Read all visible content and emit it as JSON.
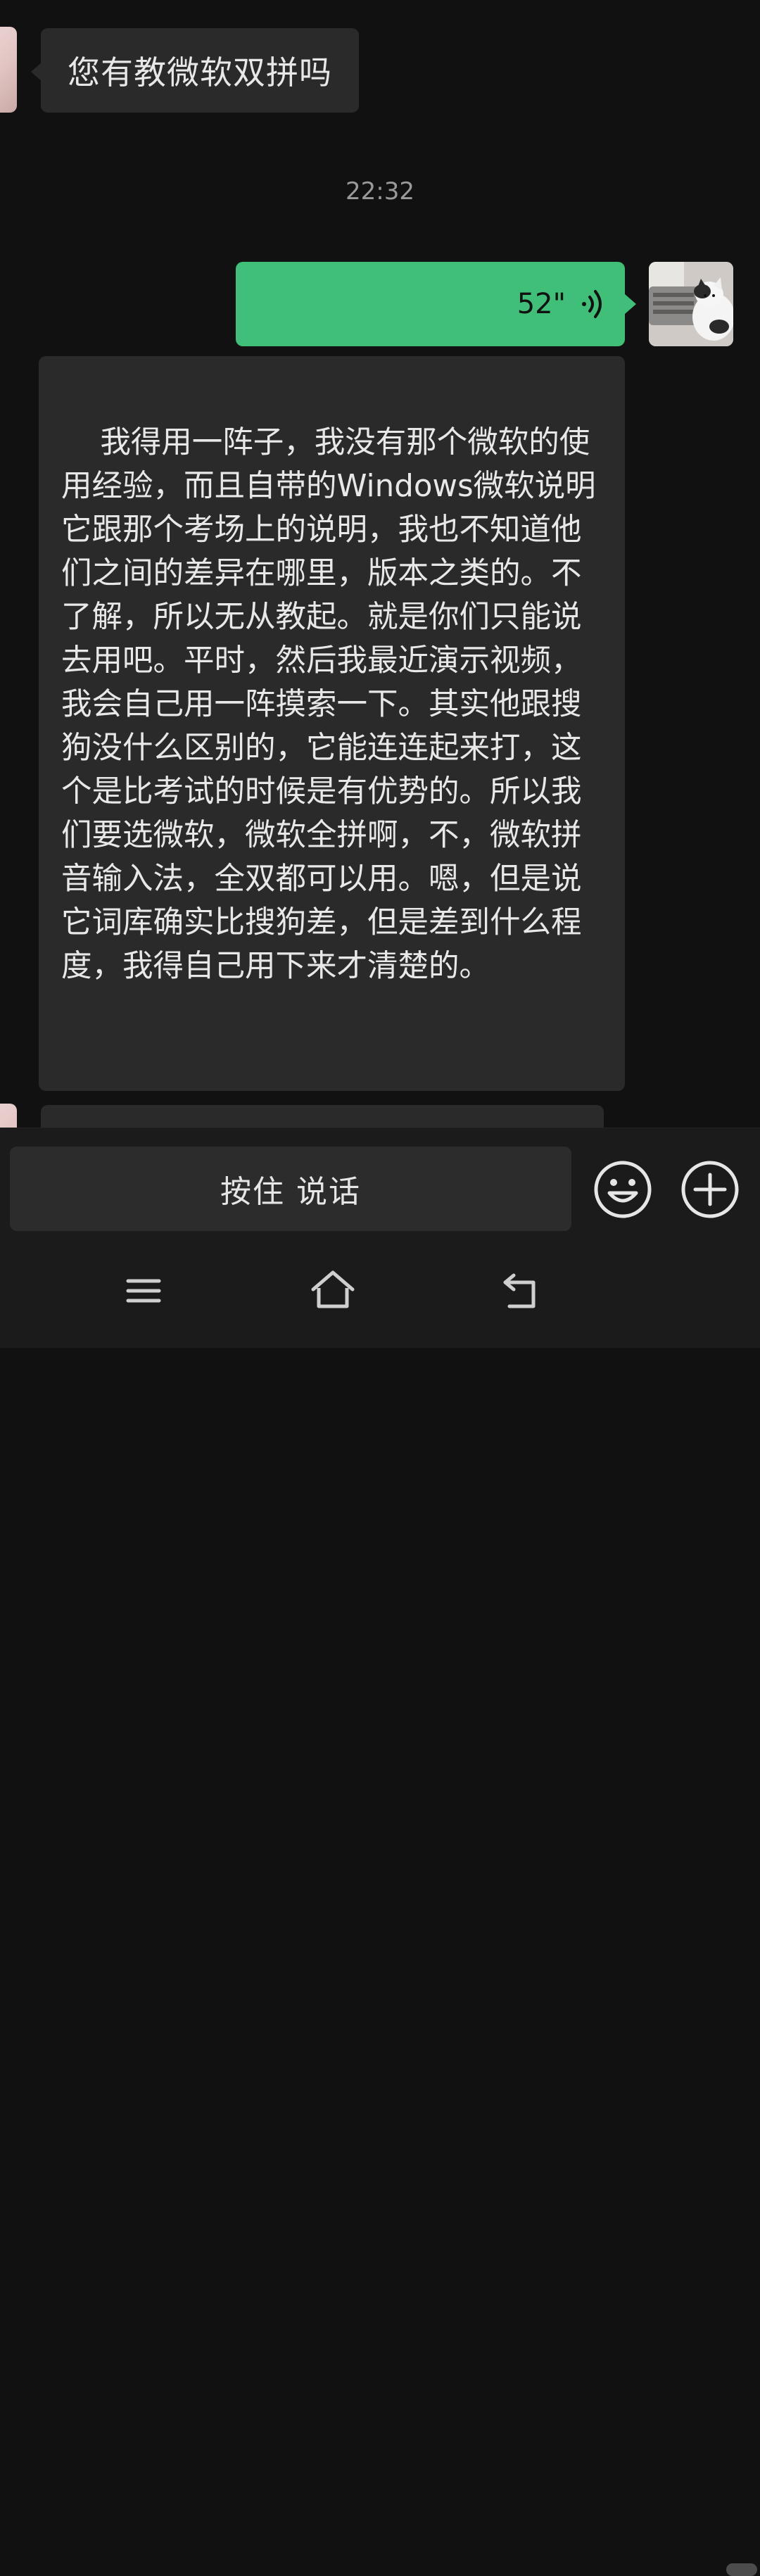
{
  "messages": [
    {
      "type": "received",
      "text": "您有教微软双拼吗"
    },
    {
      "type": "timestamp",
      "text": "22:32"
    },
    {
      "type": "sent-voice",
      "duration": "52\""
    },
    {
      "type": "received",
      "text": "我得用一阵子，我没有那个微软的使用经验，而且自带的Windows微软说明它跟那个考场上的说明，我也不知道他们之间的差异在哪里，版本之类的。不了解，所以无从教起。就是你们只能说去用吧。平时，然后我最近演示视频，我会自己用一阵摸索一下。其实他跟搜狗没什么区别的，它能连连起来打，这个是比考试的时候是有优势的。所以我们要选微软，微软全拼啊，不，微软拼音输入法，全双都可以用。嗯，但是说它词库确实比搜狗差，但是差到什么程度，我得自己用下来才清楚的。"
    }
  ],
  "input_bar": {
    "hold_to_talk_label": "按住 说话",
    "emoji_icon": "emoji-icon",
    "plus_icon": "plus-icon"
  },
  "nav_bar": {
    "icons": [
      "menu-icon",
      "home-icon",
      "back-icon"
    ]
  },
  "colors": {
    "background": "#111111",
    "received_bubble": "#2a2a2a",
    "sent_bubble": "#3fbf78",
    "input_bar": "#1b1b1b"
  }
}
